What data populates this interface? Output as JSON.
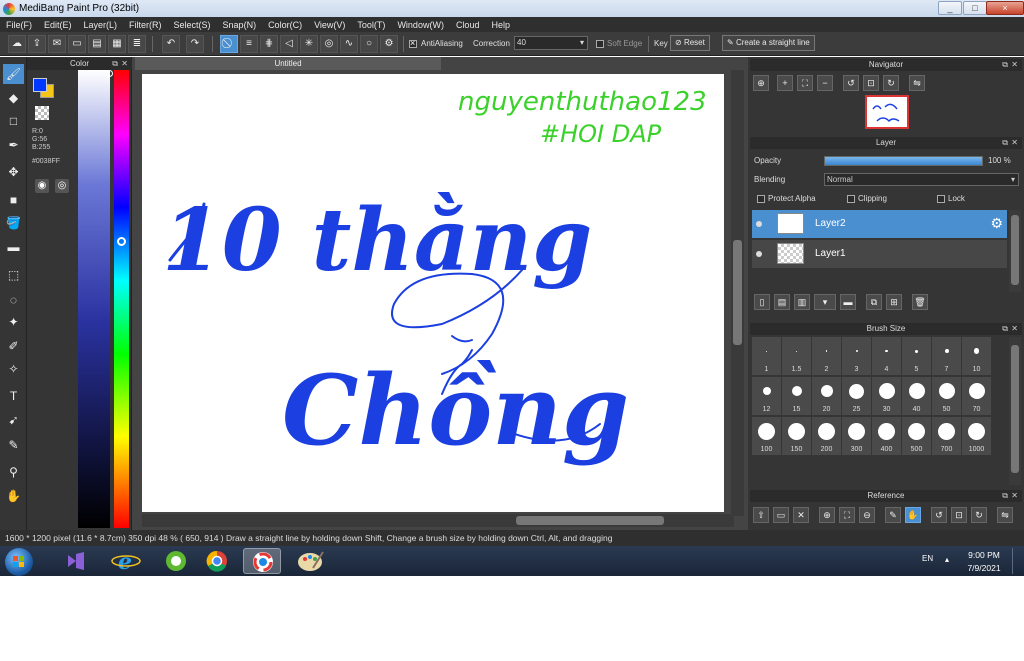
{
  "window": {
    "title": "MediBang Paint Pro (32bit)",
    "min": "_",
    "max": "□",
    "close": "×"
  },
  "menu": [
    "File(F)",
    "Edit(E)",
    "Layer(L)",
    "Filter(R)",
    "Select(S)",
    "Snap(N)",
    "Color(C)",
    "View(V)",
    "Tool(T)",
    "Window(W)",
    "Cloud",
    "Help"
  ],
  "toolbar": {
    "antialiasing_label": "AntiAliasing",
    "correction_label": "Correction",
    "correction_value": "40",
    "soft_edge_label": "Soft Edge",
    "key_label": "Key",
    "reset_label": "Reset",
    "straight_line_label": "Create a straight line"
  },
  "color_panel": {
    "title": "Color",
    "r": "R:0",
    "g": "G:56",
    "b": "B:255",
    "hex": "#0038FF",
    "main_color": "#0038ff",
    "sub_color": "#f5c518"
  },
  "document": {
    "tab_title": "Untitled",
    "ink_color": "#1b3fe0",
    "sign_color": "#3ad12a",
    "text_line1": "10 thằng",
    "text_line2": "Chồng",
    "signature_line1": "nguyenthuthao123",
    "signature_line2": "#HOI DAP"
  },
  "navigator": {
    "title": "Navigator"
  },
  "layer_panel": {
    "title": "Layer",
    "opacity_label": "Opacity",
    "opacity_value": "100 %",
    "opacity_fraction": 1.0,
    "blending_label": "Blending",
    "blending_value": "Normal",
    "protect_alpha_label": "Protect Alpha",
    "clipping_label": "Clipping",
    "lock_label": "Lock",
    "layers": [
      {
        "name": "Layer2",
        "selected": true
      },
      {
        "name": "Layer1",
        "selected": false
      }
    ]
  },
  "brush_panel": {
    "title": "Brush Size",
    "sizes": [
      "1",
      "1.5",
      "2",
      "3",
      "4",
      "5",
      "7",
      "10",
      "12",
      "15",
      "20",
      "25",
      "30",
      "40",
      "50",
      "70",
      "100",
      "150",
      "200",
      "300",
      "400",
      "500",
      "700",
      "1000"
    ]
  },
  "reference_panel": {
    "title": "Reference"
  },
  "status": {
    "text": "1600 * 1200 pixel   (11.6 * 8.7cm)  350 dpi   48 %   ( 650, 914 )   Draw a straight line by holding down Shift, Change a brush size by holding down Ctrl, Alt, and dragging"
  },
  "taskbar": {
    "lang": "EN",
    "time": "9:00 PM",
    "date": "7/9/2021"
  }
}
